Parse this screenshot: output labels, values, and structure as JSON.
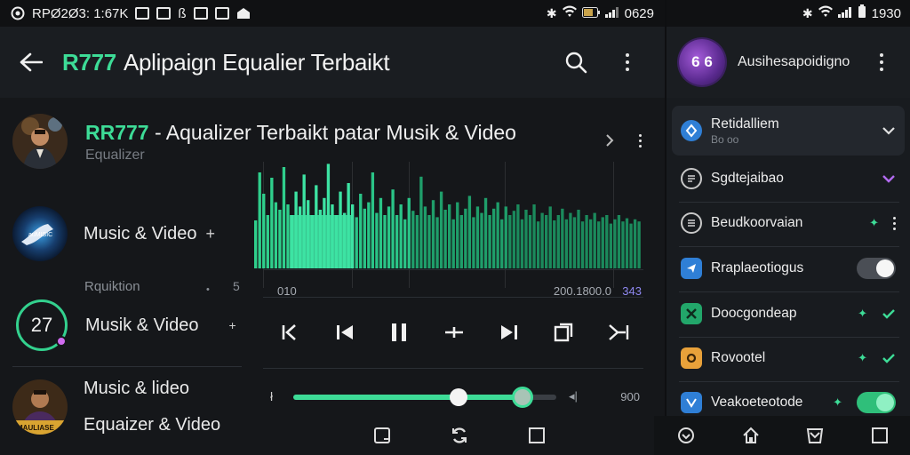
{
  "status_left": {
    "text": "RPØ2Ø3: 1:67K",
    "time": "0629"
  },
  "status_right": {
    "time": "1930"
  },
  "appbar": {
    "brand": "R777",
    "title": "Aplipaign Equalier Terbaikt"
  },
  "track": {
    "brand": "RR777",
    "title": " - Aqualizer Terbaikt patar Musik & Video",
    "subtitle": "Equalizer"
  },
  "list": {
    "item1": {
      "label": "Music & Video",
      "plus": "+"
    },
    "section": {
      "label": "Rquiktion",
      "dot": "•",
      "count": "5"
    },
    "item2": {
      "ring_value": "27",
      "label": "Musik & Video",
      "suffix": "+"
    },
    "item3": {
      "line1": "Music & lideo",
      "line2": "Equaizer & Video",
      "avatar_caption": "MAULIASE"
    }
  },
  "visualizer": {
    "axis_left": "010",
    "axis_right": "200.1800.0",
    "axis_right_accent": "343",
    "bars": [
      0.45,
      0.9,
      0.7,
      0.5,
      0.85,
      0.62,
      0.55,
      0.95,
      0.6,
      0.5,
      0.72,
      0.58,
      0.88,
      0.64,
      0.5,
      0.78,
      0.55,
      0.66,
      0.98,
      0.6,
      0.5,
      0.72,
      0.52,
      0.8,
      0.6,
      0.48,
      0.7,
      0.56,
      0.62,
      0.9,
      0.52,
      0.66,
      0.5,
      0.58,
      0.74,
      0.5,
      0.6,
      0.46,
      0.66,
      0.54,
      0.5,
      0.86,
      0.58,
      0.5,
      0.64,
      0.48,
      0.72,
      0.55,
      0.6,
      0.46,
      0.62,
      0.5,
      0.56,
      0.68,
      0.48,
      0.58,
      0.52,
      0.66,
      0.5,
      0.56,
      0.62,
      0.46,
      0.58,
      0.5,
      0.54,
      0.6,
      0.46,
      0.55,
      0.5,
      0.6,
      0.44,
      0.52,
      0.5,
      0.58,
      0.45,
      0.5,
      0.56,
      0.46,
      0.52,
      0.48,
      0.55,
      0.44,
      0.5,
      0.46,
      0.52,
      0.44,
      0.48,
      0.5,
      0.42,
      0.46,
      0.5,
      0.44,
      0.47,
      0.42,
      0.46,
      0.44
    ]
  },
  "slider": {
    "value_primary": 0.63,
    "value_secondary": 0.87,
    "end_value": "900"
  },
  "panel": {
    "account_initials": "6 6",
    "account_name": "Ausihesapoidigno",
    "rows": [
      {
        "label": "Retidalliem",
        "sub": "Bo oo",
        "icon_color": "#2f7fd6",
        "icon": "location-icon"
      },
      {
        "label": "Sgdtejaibao",
        "icon_color": "#2a2d31",
        "icon": "document-icon",
        "check_color": "#b26bf0"
      },
      {
        "label": "Beudkoorvaian",
        "icon_color": "#2a2d31",
        "icon": "lines-icon"
      },
      {
        "label": "Rraplaeotiogus",
        "icon_color": "#2f7fd6",
        "icon": "plane-icon",
        "toggle": "off"
      },
      {
        "label": "Doocgondeap",
        "icon_color": "#22a66a",
        "icon": "tools-icon"
      },
      {
        "label": "Rovootel",
        "icon_color": "#e8a13a",
        "icon": "link-icon"
      },
      {
        "label": "Veakoeteotode",
        "icon_color": "#2f7fd6",
        "icon": "envelope-icon",
        "toggle": "on"
      }
    ]
  },
  "colors": {
    "accent": "#3ddc97",
    "accent_dark": "#1f8a5d",
    "purple": "#b26bf0"
  }
}
